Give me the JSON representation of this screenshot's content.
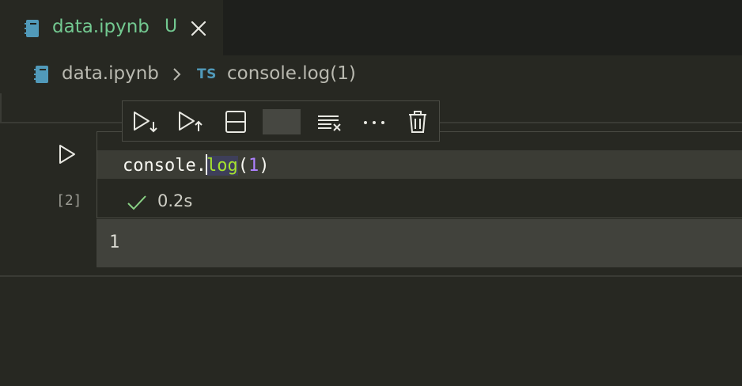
{
  "tabs": [
    {
      "label": "data.ipynb",
      "badge": "U",
      "icon": "notebook-icon",
      "active": true
    }
  ],
  "breadcrumb": {
    "file": "data.ipynb",
    "language_badge": "TS",
    "symbol": "console.log(1)"
  },
  "cell": {
    "execution_count": "[2]",
    "code": {
      "object": "console",
      "dot": ".",
      "method": "log",
      "open_paren": "(",
      "arg": "1",
      "close_paren": ")"
    },
    "status": {
      "icon": "check-icon",
      "duration": "0.2s"
    },
    "output": "1"
  },
  "cell_toolbar": {
    "buttons": [
      "run-below-icon",
      "run-above-icon",
      "split-cell-icon",
      "cell-swatch",
      "clear-output-icon",
      "more-actions-icon",
      "delete-cell-icon"
    ]
  },
  "colors": {
    "modified_green": "#73c991",
    "ts_blue": "#519aba",
    "method_green": "#a6e22e",
    "number_purple": "#ae81ff",
    "check_green": "#89d185"
  }
}
